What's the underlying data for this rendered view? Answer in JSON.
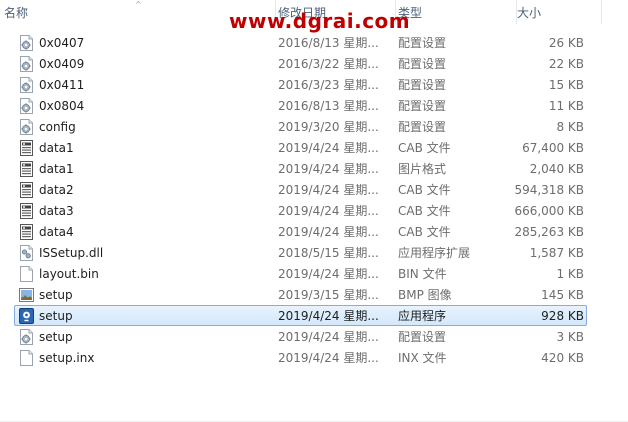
{
  "columns": {
    "name": "名称",
    "date": "修改日期",
    "type": "类型",
    "size": "大小"
  },
  "watermark": "www.dgrai.com",
  "files": [
    {
      "name": "0x0407",
      "date": "2016/8/13 星期...",
      "type": "配置设置",
      "size": "26 KB",
      "icon": "config-settings-icon",
      "selected": false
    },
    {
      "name": "0x0409",
      "date": "2016/3/22 星期...",
      "type": "配置设置",
      "size": "22 KB",
      "icon": "config-settings-icon",
      "selected": false
    },
    {
      "name": "0x0411",
      "date": "2016/3/23 星期...",
      "type": "配置设置",
      "size": "15 KB",
      "icon": "config-settings-icon",
      "selected": false
    },
    {
      "name": "0x0804",
      "date": "2016/8/13 星期...",
      "type": "配置设置",
      "size": "11 KB",
      "icon": "config-settings-icon",
      "selected": false
    },
    {
      "name": "config",
      "date": "2019/3/20 星期...",
      "type": "配置设置",
      "size": "8 KB",
      "icon": "config-settings-icon",
      "selected": false
    },
    {
      "name": "data1",
      "date": "2019/4/24 星期...",
      "type": "CAB 文件",
      "size": "67,400 KB",
      "icon": "cab-file-icon",
      "selected": false
    },
    {
      "name": "data1",
      "date": "2019/4/24 星期...",
      "type": "图片格式",
      "size": "2,040 KB",
      "icon": "cab-file-icon",
      "selected": false
    },
    {
      "name": "data2",
      "date": "2019/4/24 星期...",
      "type": "CAB 文件",
      "size": "594,318 KB",
      "icon": "cab-file-icon",
      "selected": false
    },
    {
      "name": "data3",
      "date": "2019/4/24 星期...",
      "type": "CAB 文件",
      "size": "666,000 KB",
      "icon": "cab-file-icon",
      "selected": false
    },
    {
      "name": "data4",
      "date": "2019/4/24 星期...",
      "type": "CAB 文件",
      "size": "285,263 KB",
      "icon": "cab-file-icon",
      "selected": false
    },
    {
      "name": "ISSetup.dll",
      "date": "2018/5/15 星期...",
      "type": "应用程序扩展",
      "size": "1,587 KB",
      "icon": "dll-file-icon",
      "selected": false
    },
    {
      "name": "layout.bin",
      "date": "2019/4/24 星期...",
      "type": "BIN 文件",
      "size": "1 KB",
      "icon": "blank-file-icon",
      "selected": false
    },
    {
      "name": "setup",
      "date": "2019/3/15 星期...",
      "type": "BMP 图像",
      "size": "145 KB",
      "icon": "bmp-image-icon",
      "selected": false
    },
    {
      "name": "setup",
      "date": "2019/4/24 星期...",
      "type": "应用程序",
      "size": "928 KB",
      "icon": "setup-application-icon",
      "selected": true
    },
    {
      "name": "setup",
      "date": "2019/4/24 星期...",
      "type": "配置设置",
      "size": "3 KB",
      "icon": "config-settings-icon",
      "selected": false
    },
    {
      "name": "setup.inx",
      "date": "2019/4/24 星期...",
      "type": "INX 文件",
      "size": "420 KB",
      "icon": "blank-file-icon",
      "selected": false
    }
  ]
}
